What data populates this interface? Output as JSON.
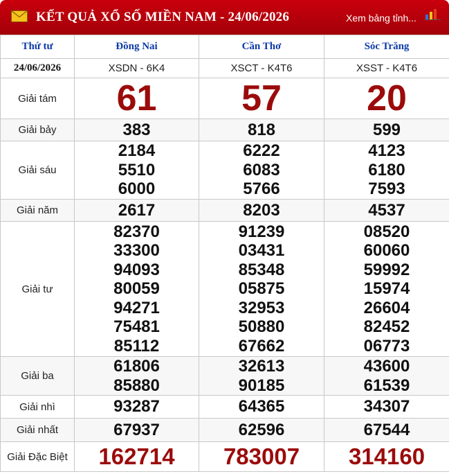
{
  "header": {
    "title": "KẾT QUẢ XỔ SỐ MIỀN NAM - 24/06/2026",
    "view_link": "Xem bảng tỉnh...",
    "icons": [
      "envelope-icon",
      "bar-chart-icon"
    ],
    "brand_color": "#b8000b"
  },
  "table": {
    "day_header": "Thứ tư",
    "date": "24/06/2026",
    "provinces": [
      {
        "name": "Đồng Nai",
        "code": "XSDN - 6K4"
      },
      {
        "name": "Cần Thơ",
        "code": "XSCT - K4T6"
      },
      {
        "name": "Sóc Trăng",
        "code": "XSST - K4T6"
      }
    ],
    "prizes": {
      "g8": {
        "label": "Giải tám",
        "values": [
          [
            "61"
          ],
          [
            "57"
          ],
          [
            "20"
          ]
        ]
      },
      "g7": {
        "label": "Giải bảy",
        "values": [
          [
            "383"
          ],
          [
            "818"
          ],
          [
            "599"
          ]
        ]
      },
      "g6": {
        "label": "Giải sáu",
        "values": [
          [
            "2184",
            "5510",
            "6000"
          ],
          [
            "6222",
            "6083",
            "5766"
          ],
          [
            "4123",
            "6180",
            "7593"
          ]
        ]
      },
      "g5": {
        "label": "Giải năm",
        "values": [
          [
            "2617"
          ],
          [
            "8203"
          ],
          [
            "4537"
          ]
        ]
      },
      "g4": {
        "label": "Giải tư",
        "values": [
          [
            "82370",
            "33300",
            "94093",
            "80059",
            "94271",
            "75481",
            "85112"
          ],
          [
            "91239",
            "03431",
            "85348",
            "05875",
            "32953",
            "50880",
            "67662"
          ],
          [
            "08520",
            "60060",
            "59992",
            "15974",
            "26604",
            "82452",
            "06773"
          ]
        ]
      },
      "g3": {
        "label": "Giải ba",
        "values": [
          [
            "61806",
            "85880"
          ],
          [
            "32613",
            "90185"
          ],
          [
            "43600",
            "61539"
          ]
        ]
      },
      "g2": {
        "label": "Giải nhì",
        "values": [
          [
            "93287"
          ],
          [
            "64365"
          ],
          [
            "34307"
          ]
        ]
      },
      "g1": {
        "label": "Giải nhất",
        "values": [
          [
            "67937"
          ],
          [
            "62596"
          ],
          [
            "67544"
          ]
        ]
      },
      "db": {
        "label": "Giải Đặc Biệt",
        "values": [
          [
            "162714"
          ],
          [
            "783007"
          ],
          [
            "314160"
          ]
        ]
      }
    }
  }
}
